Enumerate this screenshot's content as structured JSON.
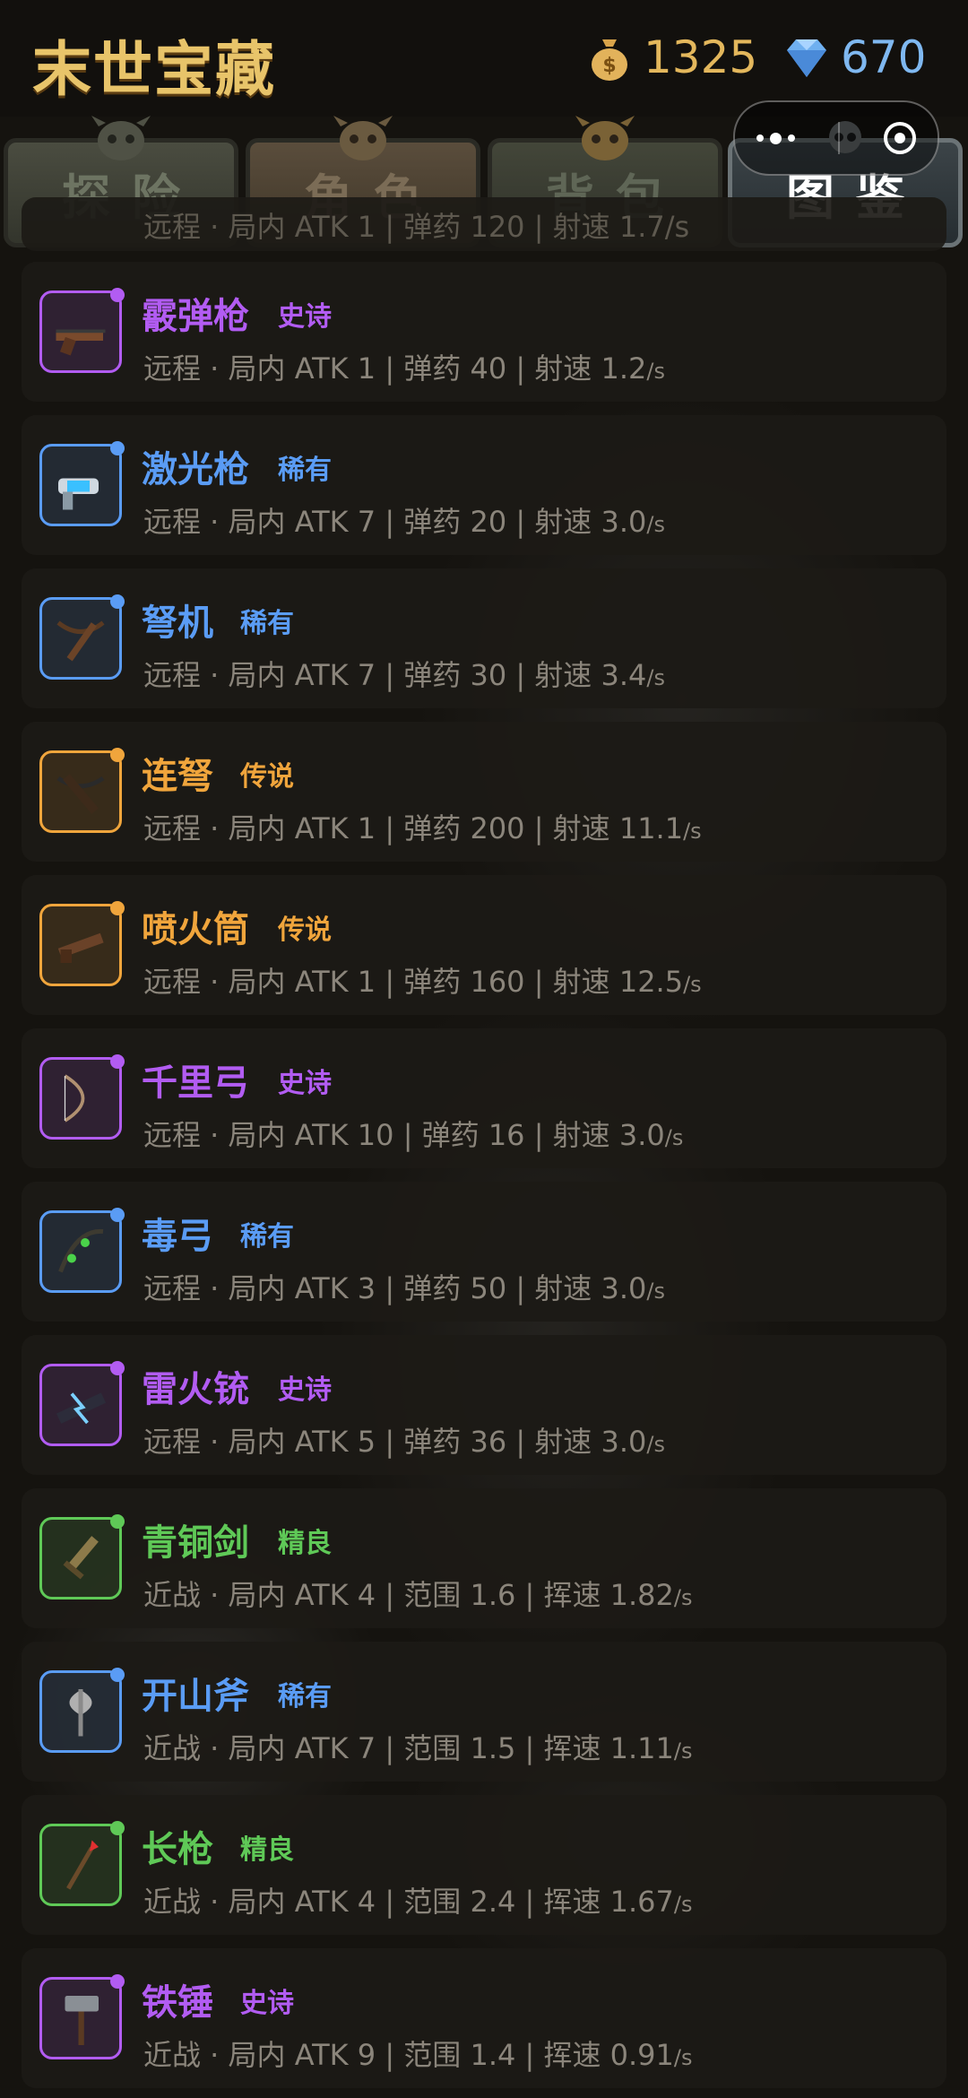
{
  "header": {
    "title": "末世宝藏",
    "coins": "1325",
    "gems": "670",
    "coin_icon": "money-bag-icon",
    "gem_icon": "diamond-icon"
  },
  "tabs": [
    {
      "label": "探险",
      "active": false
    },
    {
      "label": "角色",
      "active": false
    },
    {
      "label": "背包",
      "active": false
    },
    {
      "label": "图鉴",
      "active": true
    }
  ],
  "partial_row": "远程 · 局内 ATK 1 | 弹药 120 | 射速 1.7/s",
  "items": [
    {
      "name": "霰弹枪",
      "rarity": "史诗",
      "color": "#b25cf2",
      "icon": "shotgun-icon",
      "stats": "远程 · 局内  ATK 1 | 弹药 40 | 射速 1.2",
      "unit": "/s"
    },
    {
      "name": "激光枪",
      "rarity": "稀有",
      "color": "#5a9cf5",
      "icon": "laser-gun-icon",
      "stats": "远程 · 局内  ATK 7 | 弹药 20 | 射速 3.0",
      "unit": "/s"
    },
    {
      "name": "弩机",
      "rarity": "稀有",
      "color": "#5a9cf5",
      "icon": "crossbow-icon",
      "stats": "远程 · 局内  ATK 7 | 弹药 30 | 射速 3.4",
      "unit": "/s"
    },
    {
      "name": "连弩",
      "rarity": "传说",
      "color": "#f0a53c",
      "icon": "repeating-crossbow-icon",
      "stats": "远程 · 局内  ATK 1 | 弹药 200 | 射速 11.1",
      "unit": "/s"
    },
    {
      "name": "喷火筒",
      "rarity": "传说",
      "color": "#f0a53c",
      "icon": "flamethrower-icon",
      "stats": "远程 · 局内  ATK 1 | 弹药 160 | 射速 12.5",
      "unit": "/s"
    },
    {
      "name": "千里弓",
      "rarity": "史诗",
      "color": "#b25cf2",
      "icon": "longbow-icon",
      "stats": "远程 · 局内  ATK 10 | 弹药 16 | 射速 3.0",
      "unit": "/s"
    },
    {
      "name": "毒弓",
      "rarity": "稀有",
      "color": "#5a9cf5",
      "icon": "poison-bow-icon",
      "stats": "远程 · 局内  ATK 3 | 弹药 50 | 射速 3.0",
      "unit": "/s"
    },
    {
      "name": "雷火铳",
      "rarity": "史诗",
      "color": "#b25cf2",
      "icon": "thunder-gun-icon",
      "stats": "远程 · 局内  ATK 5 | 弹药 36 | 射速 3.0",
      "unit": "/s"
    },
    {
      "name": "青铜剑",
      "rarity": "精良",
      "color": "#5fc957",
      "icon": "bronze-sword-icon",
      "stats": "近战 · 局内  ATK 4 | 范围 1.6 | 挥速 1.82",
      "unit": "/s"
    },
    {
      "name": "开山斧",
      "rarity": "稀有",
      "color": "#5a9cf5",
      "icon": "battle-axe-icon",
      "stats": "近战 · 局内  ATK 7 | 范围 1.5 | 挥速 1.11",
      "unit": "/s"
    },
    {
      "name": "长枪",
      "rarity": "精良",
      "color": "#5fc957",
      "icon": "spear-icon",
      "stats": "近战 · 局内  ATK 4 | 范围 2.4 | 挥速 1.67",
      "unit": "/s"
    },
    {
      "name": "铁锤",
      "rarity": "史诗",
      "color": "#b25cf2",
      "icon": "hammer-icon",
      "stats": "近战 · 局内  ATK 9 | 范围 1.4 | 挥速 0.91",
      "unit": "/s"
    }
  ]
}
